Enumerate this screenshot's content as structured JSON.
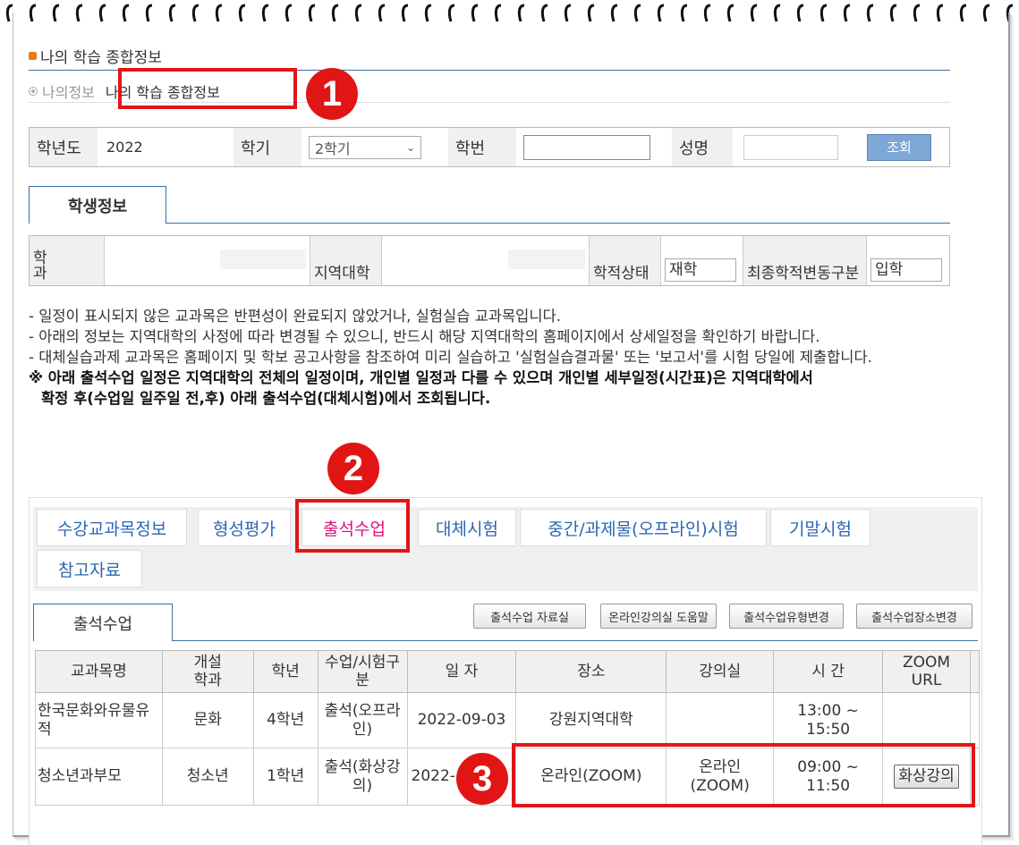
{
  "header": {
    "page_title": "나의 학습 종합정보",
    "breadcrumb_parent": "나의정보",
    "breadcrumb_current": "나의 학습 종합정보"
  },
  "search": {
    "year_label": "학년도",
    "year_value": "2022",
    "term_label": "학기",
    "term_value": "2학기",
    "student_id_label": "학번",
    "name_label": "성명",
    "search_button": "조회"
  },
  "student_info": {
    "tab_label": "학생정보",
    "dept_label": "학과",
    "regional_label": "지역대학",
    "status_label": "학적상태",
    "status_value": "재학",
    "change_label": "최종학적변동구분",
    "change_value": "입학"
  },
  "notices": [
    "- 일정이 표시되지 않은 교과목은 반편성이 완료되지 않았거나, 실험실습 교과목입니다.",
    "- 아래의 정보는 지역대학의 사정에 따라 변경될 수 있으니, 반드시 해당 지역대학의 홈페이지에서 상세일정을 확인하기 바랍니다.",
    "- 대체실습과제 교과목은 홈페이지 및 학보 공고사항을 참조하여 미리 실습하고 '실험실습결과물' 또는 '보고서'를 시험 당일에 제출합니다."
  ],
  "notice_bold_1": "※ 아래 출석수업 일정은 지역대학의 전체의 일정이며, 개인별 일정과 다를 수 있으며 개인별 세부일정(시간표)은 지역대학에서",
  "notice_bold_2": "확정 후(수업일 일주일 전,후) 아래 출석수업(대체시험)에서 조회됩니다.",
  "tabs": [
    "수강교과목정보",
    "형성평가",
    "출석수업",
    "대체시험",
    "중간/과제물(오프라인)시험",
    "기말시험",
    "참고자료"
  ],
  "attendance": {
    "sub_tab": "출석수업",
    "buttons": [
      "출석수업 자료실",
      "온라인강의실 도움말",
      "출석수업유형변경",
      "출석수업장소변경"
    ],
    "columns": [
      "교과목명",
      "개설학과",
      "학년",
      "수업/시험구분",
      "일 자",
      "장소",
      "강의실",
      "시 간",
      "ZOOM URL"
    ],
    "rows": [
      {
        "course": "한국문화와유물유적",
        "dept": "문화",
        "grade": "4학년",
        "type": "출석(오프라인)",
        "date": "2022-09-03",
        "place": "강원지역대학",
        "room": "",
        "time": "13:00 ~ 15:50",
        "zoom": ""
      },
      {
        "course": "청소년과부모",
        "dept": "청소년",
        "grade": "1학년",
        "type": "출석(화상강의)",
        "date": "2022-",
        "place": "온라인(ZOOM)",
        "room": "온라인 (ZOOM)",
        "time": "09:00 ~ 11:50",
        "zoom": "화상강의"
      }
    ]
  },
  "annotations": [
    "1",
    "2",
    "3"
  ],
  "colors": {
    "accent_red": "#e21515",
    "tab_active": "#e0107a",
    "tab_text": "#2a67b0",
    "bullet": "#e87a1e"
  }
}
